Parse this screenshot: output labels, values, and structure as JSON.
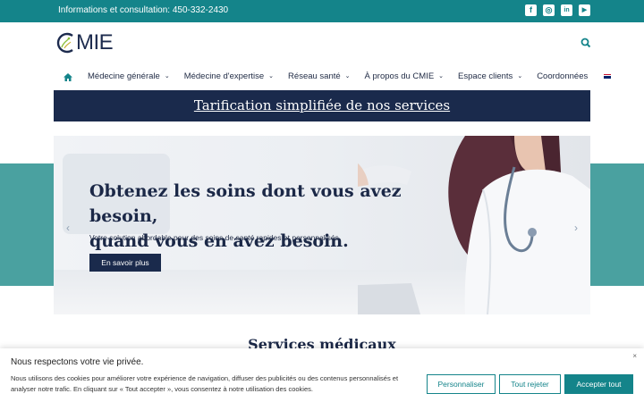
{
  "topbar": {
    "info": "Informations et consultation: 450-332-2430",
    "social": [
      {
        "icon": "facebook-icon",
        "glyph": "f"
      },
      {
        "icon": "instagram-icon",
        "glyph": "◎"
      },
      {
        "icon": "linkedin-icon",
        "glyph": "in"
      },
      {
        "icon": "youtube-icon",
        "glyph": "▶"
      }
    ],
    "color": "#14848a"
  },
  "header": {
    "logo_text": "MIE",
    "logo_icon": "cmie-logo-c"
  },
  "nav": {
    "home_icon": "home-icon",
    "items": [
      {
        "label": "Médecine générale",
        "dropdown": true
      },
      {
        "label": "Médecine d'expertise",
        "dropdown": true
      },
      {
        "label": "Réseau santé",
        "dropdown": true
      },
      {
        "label": "À propos du CMIE",
        "dropdown": true
      },
      {
        "label": "Espace clients",
        "dropdown": true
      },
      {
        "label": "Coordonnées",
        "dropdown": false
      }
    ],
    "language_icon": "uk-flag-icon"
  },
  "banner": {
    "text": "Tarification simplifiée de nos services",
    "color": "#1a2a4c"
  },
  "hero": {
    "title_line1": "Obtenez les soins dont vous avez besoin,",
    "title_line2": "quand vous en avez besoin.",
    "subtitle": "Votre solution abordable pour des soins de santé rapides et personnalisés.",
    "button": "En savoir plus",
    "prev_icon": "chevron-left-icon",
    "next_icon": "chevron-right-icon"
  },
  "section": {
    "title": "Services médicaux"
  },
  "cookie": {
    "title": "Nous respectons votre vie privée.",
    "text": "Nous utilisons des cookies pour améliorer votre expérience de navigation, diffuser des publicités ou des contenus personnalisés et analyser notre trafic. En cliquant sur « Tout accepter », vous consentez à notre utilisation des cookies.",
    "customize": "Personnaliser",
    "reject": "Tout rejeter",
    "accept": "Accepter tout",
    "close": "×",
    "accent": "#14848a"
  }
}
